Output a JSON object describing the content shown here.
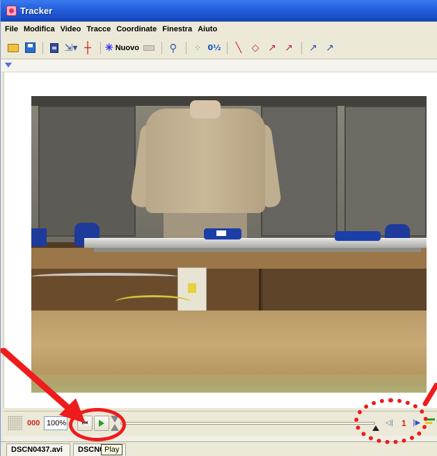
{
  "window": {
    "title": "Tracker"
  },
  "menu": [
    "File",
    "Modifica",
    "Video",
    "Tracce",
    "Coordinate",
    "Finestra",
    "Aiuto"
  ],
  "toolbar": {
    "new_label": "Nuovo",
    "frac_label": "0½",
    "icons": [
      "open-folder-icon",
      "save-icon",
      "video-clip-icon",
      "calibration-dropdown-icon",
      "axes-icon",
      "new-track-icon",
      "magnifier-icon",
      "trails-icon",
      "fraction-icon",
      "line-icon",
      "marker-icon",
      "velocity-vector-icon",
      "acceleration-vector-icon",
      "force-vector-icon",
      "momentum-vector-icon"
    ]
  },
  "player": {
    "frame": "000",
    "zoom": "100%",
    "step_number": "1",
    "tooltip": "Play"
  },
  "tabs": [
    {
      "label": "DSCN0437.avi",
      "selected": true
    },
    {
      "label": "DSCN04",
      "selected": false
    }
  ],
  "colors": {
    "annotation": "#ee1c1c",
    "titlebar": "#2561e0",
    "frame_number": "#d02020",
    "play_green": "#20a020"
  }
}
